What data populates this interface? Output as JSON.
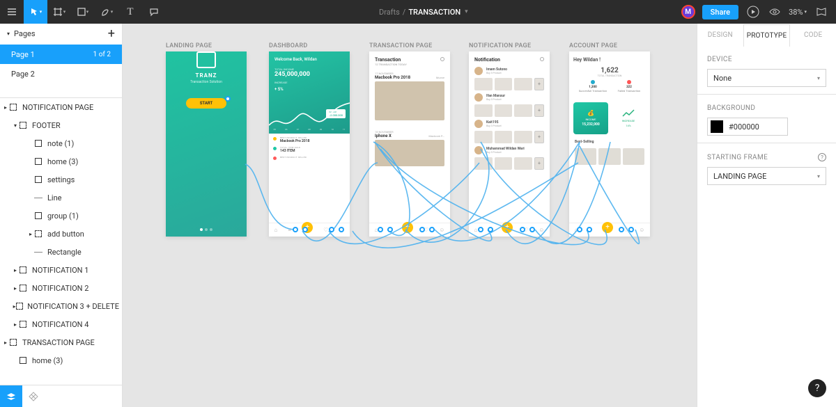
{
  "topbar": {
    "drafts": "Drafts",
    "sep": "/",
    "title": "TRANSACTION",
    "avatar_letter": "M",
    "share": "Share",
    "zoom": "38%"
  },
  "pages": {
    "header": "Pages",
    "items": [
      {
        "label": "Page 1",
        "count": "1 of 2",
        "active": true
      },
      {
        "label": "Page 2",
        "count": "",
        "active": false
      }
    ]
  },
  "layers": [
    {
      "indent": 0,
      "icon": "frame",
      "arrow": "▸",
      "label": "NOTIFICATION PAGE"
    },
    {
      "indent": 1,
      "icon": "frame",
      "arrow": "▾",
      "label": "FOOTER"
    },
    {
      "indent": 2,
      "icon": "comp",
      "arrow": "",
      "label": "note (1)"
    },
    {
      "indent": 2,
      "icon": "comp",
      "arrow": "",
      "label": "home (3)"
    },
    {
      "indent": 2,
      "icon": "comp",
      "arrow": "",
      "label": "settings"
    },
    {
      "indent": 2,
      "icon": "line",
      "arrow": "",
      "label": "Line"
    },
    {
      "indent": 2,
      "icon": "comp",
      "arrow": "",
      "label": "group (1)"
    },
    {
      "indent": 2,
      "icon": "frame",
      "arrow": "▸",
      "label": "add button"
    },
    {
      "indent": 2,
      "icon": "line",
      "arrow": "",
      "label": "Rectangle"
    },
    {
      "indent": 1,
      "icon": "frame",
      "arrow": "▸",
      "label": "NOTIFICATION 1"
    },
    {
      "indent": 1,
      "icon": "frame",
      "arrow": "▸",
      "label": "NOTIFICATION 2"
    },
    {
      "indent": 1,
      "icon": "frame",
      "arrow": "▸",
      "label": "NOTIFICATION 3 + DELETE"
    },
    {
      "indent": 1,
      "icon": "frame",
      "arrow": "▸",
      "label": "NOTIFICATION 4"
    },
    {
      "indent": 0,
      "icon": "frame",
      "arrow": "▸",
      "label": "TRANSACTION PAGE"
    },
    {
      "indent": 1,
      "icon": "comp",
      "arrow": "",
      "label": "home (3)"
    }
  ],
  "canvas": {
    "frames": {
      "landing": {
        "label": "LANDING PAGE",
        "brand": "TRANZ",
        "sub": "Transaction Solution",
        "start": "START"
      },
      "dashboard": {
        "label": "DASHBOARD",
        "welcome": "Welcome Back, Wildan",
        "total_label": "TOTAL INCOME",
        "amount": "245,000,000",
        "pct_label": "+ 5%",
        "tag": "12.000.000",
        "days": [
          "05",
          "06",
          "07",
          "08",
          "09",
          "10",
          "11"
        ],
        "items": [
          {
            "caption": "BEST PRODUCT SELLER",
            "title": "Macbook Pro 2018",
            "dot": "#ffc107"
          },
          {
            "caption": "TOTAL ITEM SOLD",
            "title": "143 ITEM",
            "dot": "#1fc7a5"
          },
          {
            "caption": "BEST PRODUCT SELLER",
            "title": "",
            "dot": "#ff5a5a"
          }
        ]
      },
      "transaction": {
        "label": "TRANSACTION PAGE",
        "title": "Transaction",
        "subtitle": "12 TRANSACTION TODAY",
        "rows": [
          {
            "date": "17 NOVEMBER",
            "product": "Macbook Pro 2018",
            "right": "Muose"
          },
          {
            "date": "18 NOVEMBER",
            "product": "Iphone X",
            "right": "Macbook P..."
          }
        ]
      },
      "notification": {
        "label": "NOTIFICATION PAGE",
        "title": "Notification",
        "subtitle": "",
        "users": [
          {
            "name": "Imam Sutono",
            "sub": "Buy 5 Product"
          },
          {
            "name": "Ifan Mansur",
            "sub": "Buy 5 Product"
          },
          {
            "name": "Kait195",
            "sub": "Buy 3 Product"
          },
          {
            "name": "Muhammad Wildan Wari",
            "sub": "Buy 5 Product"
          }
        ]
      },
      "account": {
        "label": "ACCOUNT PAGE",
        "hi": "Hey Wildan !",
        "big": "1,622",
        "lab": "TOTAL TRANSACTION",
        "stats": [
          {
            "v": "1,300",
            "l": "Succesfull Transaction"
          },
          {
            "v": "322",
            "l": "Failed Transaction"
          }
        ],
        "income_label": "INCOME",
        "income_value": "15,232,000",
        "increase_label": "INCREASE",
        "increase_value": "14%",
        "best": "Best-Selling"
      }
    }
  },
  "right": {
    "tabs": {
      "design": "DESIGN",
      "prototype": "PROTOTYPE",
      "code": "CODE"
    },
    "device_label": "DEVICE",
    "device_value": "None",
    "background_label": "BACKGROUND",
    "background_value": "#000000",
    "starting_label": "STARTING FRAME",
    "starting_value": "LANDING PAGE"
  }
}
